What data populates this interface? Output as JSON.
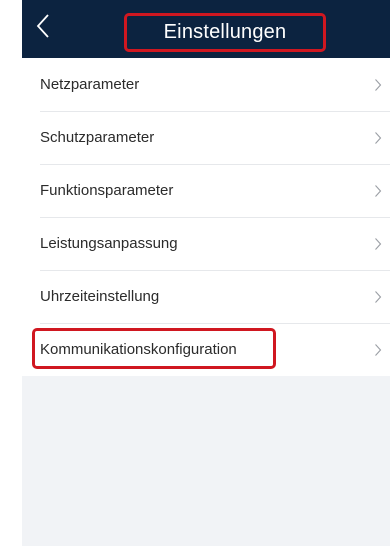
{
  "header": {
    "title": "Einstellungen",
    "back_icon": "chevron-left-icon"
  },
  "settings": {
    "items": [
      {
        "label": "Netzparameter"
      },
      {
        "label": "Schutzparameter"
      },
      {
        "label": "Funktionsparameter"
      },
      {
        "label": "Leistungsanpassung"
      },
      {
        "label": "Uhrzeiteinstellung"
      },
      {
        "label": "Kommunikationskonfiguration"
      }
    ],
    "chevron_icon": "chevron-right-icon"
  },
  "colors": {
    "header_bg": "#0c2340",
    "highlight": "#d01720",
    "page_bg": "#f1f3f6"
  }
}
